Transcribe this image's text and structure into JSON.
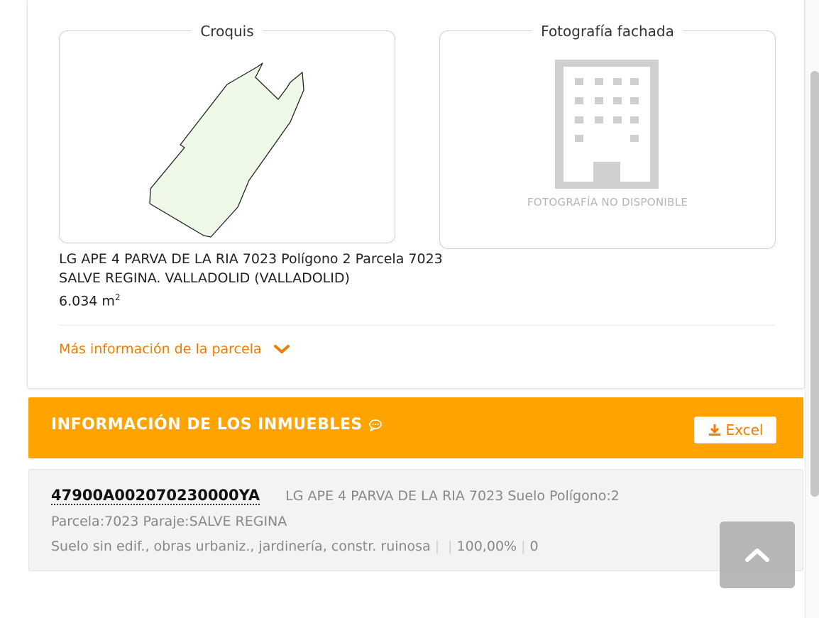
{
  "parcel": {
    "croquis_label": "Croquis",
    "photo_label": "Fotografía fachada",
    "photo_unavailable": "FOTOGRAFÍA NO DISPONIBLE",
    "address_line1": "LG APE 4 PARVA DE LA RIA 7023 Polígono 2 Parcela 7023",
    "address_line2": "SALVE REGINA. VALLADOLID (VALLADOLID)",
    "area_value": "6.034 m",
    "area_sup": "2",
    "more_info_link": "Más información de la parcela"
  },
  "properties_header": {
    "title": "INFORMACIÓN DE LOS INMUEBLES",
    "excel_label": "Excel"
  },
  "property": {
    "reference": "47900A002070230000YA",
    "desc1": "LG APE 4 PARVA DE LA RIA 7023 Suelo Polígono:2",
    "desc2": "Parcela:7023 Paraje:SALVE REGINA",
    "use": "Suelo sin edif., obras urbaniz., jardinería, constr. ruinosa",
    "sep1": "|",
    "sep2": "|",
    "percent": "100,00%",
    "sep3": "|",
    "value": "0"
  },
  "icons": [
    "chevron-down-icon",
    "chat-bubble-icon",
    "download-icon",
    "building-icon",
    "chevron-up-icon"
  ],
  "colors": {
    "accent": "#f07c00",
    "header_bar": "#ffa300",
    "parcel_fill": "#eef9e8"
  }
}
